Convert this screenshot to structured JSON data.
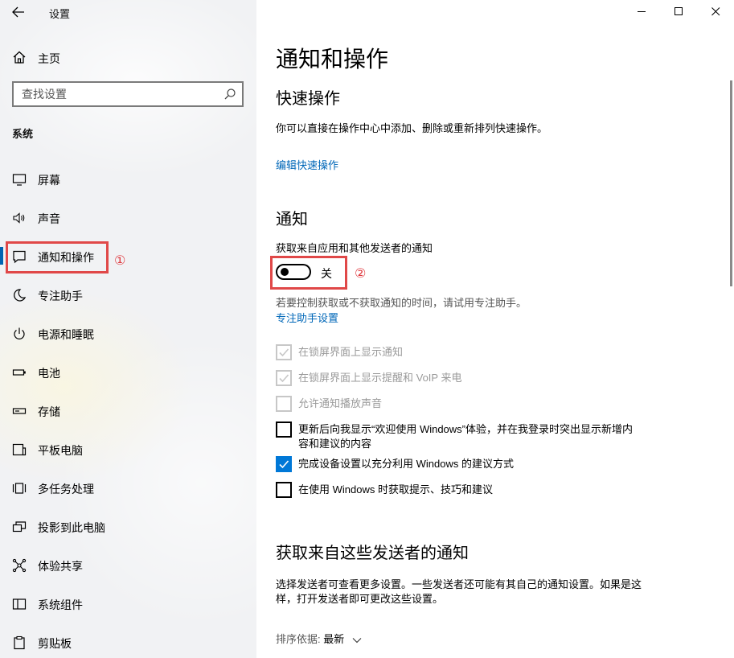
{
  "app": {
    "title": "设置"
  },
  "sidebar": {
    "home_label": "主页",
    "search_placeholder": "查找设置",
    "section_title": "系统",
    "items": [
      {
        "label": "屏幕",
        "icon": "display-icon"
      },
      {
        "label": "声音",
        "icon": "speaker-icon"
      },
      {
        "label": "通知和操作",
        "icon": "notification-icon",
        "active": true
      },
      {
        "label": "专注助手",
        "icon": "moon-icon"
      },
      {
        "label": "电源和睡眠",
        "icon": "power-icon"
      },
      {
        "label": "电池",
        "icon": "battery-icon"
      },
      {
        "label": "存储",
        "icon": "storage-icon"
      },
      {
        "label": "平板电脑",
        "icon": "tablet-icon"
      },
      {
        "label": "多任务处理",
        "icon": "multitask-icon"
      },
      {
        "label": "投影到此电脑",
        "icon": "project-icon"
      },
      {
        "label": "体验共享",
        "icon": "share-icon"
      },
      {
        "label": "系统组件",
        "icon": "components-icon"
      },
      {
        "label": "剪贴板",
        "icon": "clipboard-icon"
      }
    ]
  },
  "annotations": {
    "one": "①",
    "two": "②"
  },
  "main": {
    "title": "通知和操作",
    "quick_actions": {
      "heading": "快速操作",
      "desc": "你可以直接在操作中心中添加、删除或重新排列快速操作。",
      "link": "编辑快速操作"
    },
    "notifications": {
      "heading": "通知",
      "toggle_label": "获取来自应用和其他发送者的通知",
      "toggle_state": "关",
      "toggle_on": false,
      "hint": "若要控制获取或不获取通知的时间，请试用专注助手。",
      "focus_link": "专注助手设置",
      "checkboxes": [
        {
          "label": "在锁屏界面上显示通知",
          "checked": true,
          "disabled": true
        },
        {
          "label": "在锁屏界面上显示提醒和 VoIP 来电",
          "checked": true,
          "disabled": true
        },
        {
          "label": "允许通知播放声音",
          "checked": false,
          "disabled": true
        },
        {
          "label": "更新后向我显示“欢迎使用 Windows”体验，并在我登录时突出显示新增内容和建议的内容",
          "checked": false,
          "disabled": false
        },
        {
          "label": "完成设备设置以充分利用 Windows 的建议方式",
          "checked": true,
          "disabled": false
        },
        {
          "label": "在使用 Windows 时获取提示、技巧和建议",
          "checked": false,
          "disabled": false
        }
      ]
    },
    "senders": {
      "heading": "获取来自这些发送者的通知",
      "desc": "选择发送者可查看更多设置。一些发送者还可能有其自己的通知设置。如果是这样，打开发送者即可更改这些设置。",
      "sort_label": "排序依据:",
      "sort_value": "最新"
    }
  },
  "colors": {
    "accent": "#0078d7",
    "link": "#0067b8",
    "annotation": "#e04848"
  }
}
